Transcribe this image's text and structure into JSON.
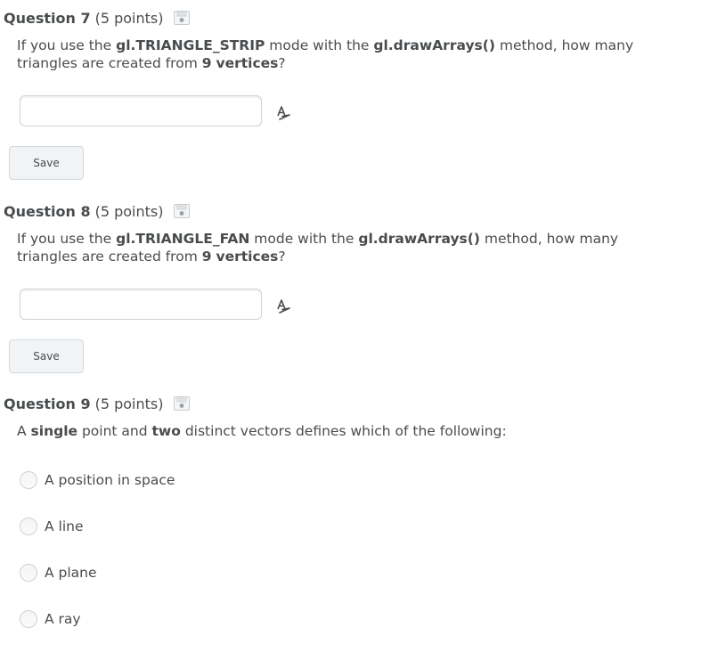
{
  "questions": [
    {
      "title": "Question 7",
      "points": "(5 points)",
      "text": {
        "p1": "If you use the ",
        "b1": "gl.TRIANGLE_STRIP",
        "p2": " mode with the ",
        "b2": "gl.drawArrays()",
        "p3": " method, how many triangles are created from ",
        "b3": "9",
        "p4": " ",
        "b4": "vertices",
        "p5": "?"
      },
      "answer_value": "",
      "save_label": "Save"
    },
    {
      "title": "Question 8",
      "points": "(5 points)",
      "text": {
        "p1": "If you use the ",
        "b1": "gl.TRIANGLE_FAN",
        "p2": " mode with the ",
        "b2": "gl.drawArrays()",
        "p3": " method, how many triangles are created from ",
        "b3": "9",
        "p4": " ",
        "b4": "vertices",
        "p5": "?"
      },
      "answer_value": "",
      "save_label": "Save"
    },
    {
      "title": "Question 9",
      "points": "(5 points)",
      "text": {
        "p1": "A ",
        "b1": "single",
        "p2": " point and ",
        "b2": "two",
        "p3": " distinct vectors defines which of the following:"
      },
      "options": [
        "A position in space",
        "A line",
        "A plane",
        "A ray"
      ]
    }
  ],
  "icons": {
    "save_state": "floppy-disk-icon",
    "spellcheck": "spell-check-icon"
  },
  "colors": {
    "text": "#494c4e",
    "border": "#cfd1d3",
    "button_bg": "#f1f3f5"
  }
}
